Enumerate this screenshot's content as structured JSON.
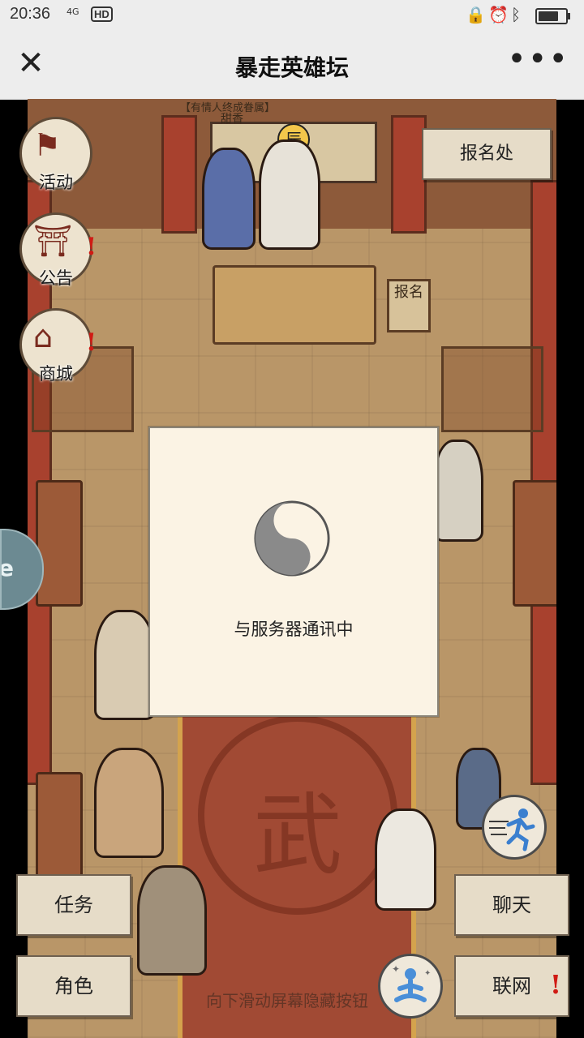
{
  "status_bar": {
    "time": "20:36",
    "network": "4G",
    "hd": "HD"
  },
  "nav": {
    "title": "暴走英雄坛"
  },
  "scene": {
    "top_caption": "【有情人终成眷属】",
    "top_name": "甜香",
    "hall_sign_char": "辰",
    "desk_sign": "报名",
    "carpet_char": "武",
    "register_button": "报名处"
  },
  "side_buttons": [
    {
      "label": "活动",
      "icon": "flag-icon",
      "alert": ""
    },
    {
      "label": "公告",
      "icon": "notice-icon",
      "alert": "!"
    },
    {
      "label": "商城",
      "icon": "shop-icon",
      "alert": "!"
    }
  ],
  "bottom_buttons": {
    "tasks": "任务",
    "role": "角色",
    "chat": "聊天",
    "network": "联网",
    "network_alert": "!"
  },
  "hint": "向下滑动屏幕隐藏按钮",
  "dialog": {
    "message": "与服务器通讯中"
  },
  "colors": {
    "panel": "#fbf3e4",
    "alert": "#d01a14",
    "carpet": "#a14a34"
  }
}
